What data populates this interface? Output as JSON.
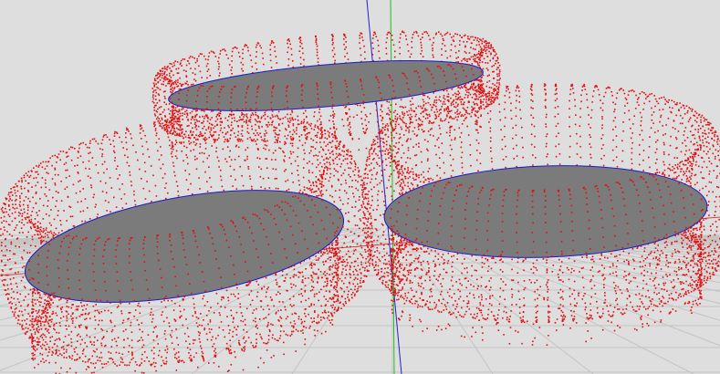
{
  "viewport": {
    "background_color": "#dedede",
    "grid_color": "#c4c4c4",
    "point_color": "#e01010",
    "disc_fill_color": "#7b7b7b",
    "disc_outline_color": "#1a1acc",
    "axis_x_color": "#d02020",
    "axis_y_color": "#20c020",
    "axis_z_color": "#2020d0",
    "objects": [
      {
        "name": "upper-torus",
        "type": "point-cloud"
      },
      {
        "name": "left-torus",
        "type": "point-cloud"
      },
      {
        "name": "right-torus",
        "type": "point-cloud"
      },
      {
        "name": "upper-cross-section-disc",
        "type": "disc"
      },
      {
        "name": "left-cross-section-disc",
        "type": "disc"
      },
      {
        "name": "right-cross-section-disc",
        "type": "disc"
      }
    ]
  }
}
